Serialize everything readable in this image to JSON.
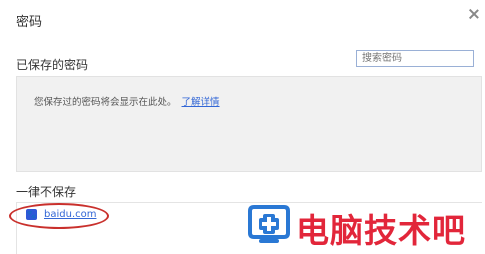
{
  "dialog": {
    "title": "密码"
  },
  "saved": {
    "heading": "已保存的密码",
    "search_placeholder": "搜索密码",
    "empty_message": "您保存过的密码将会显示在此处。",
    "learn_more": "了解详情"
  },
  "never_saved": {
    "heading": "一律不保存",
    "sites": [
      {
        "domain": "baidu.com"
      }
    ]
  },
  "watermark": {
    "text": "电脑技术吧"
  },
  "colors": {
    "link": "#3367d6",
    "highlight_ring": "#c9302c",
    "watermark": "#e2263a",
    "watermark_icon": "#2a78d4"
  }
}
